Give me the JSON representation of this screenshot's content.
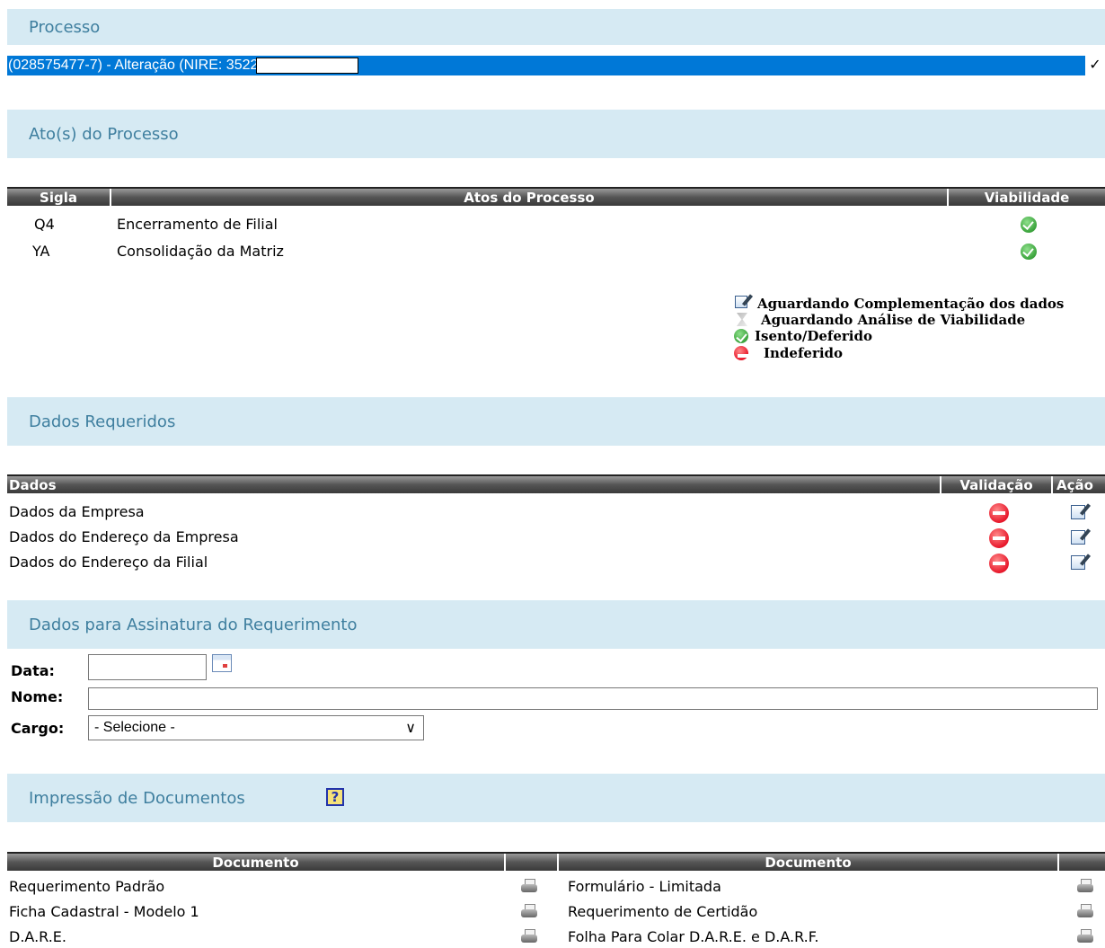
{
  "processo": {
    "title": "Processo",
    "selected": "(028575477-7) - Alteração (NIRE: 3522"
  },
  "atos": {
    "title": "Ato(s) do Processo",
    "headers": {
      "sigla": "Sigla",
      "atos": "Atos do Processo",
      "viabilidade": "Viabilidade"
    },
    "rows": [
      {
        "sigla": "Q4",
        "ato": "Encerramento de Filial",
        "status_icon": "check-circle-icon"
      },
      {
        "sigla": "YA",
        "ato": "Consolidação da Matriz",
        "status_icon": "check-circle-icon"
      }
    ],
    "legend": [
      {
        "icon": "edit-icon",
        "text": "Aguardando Complementação dos dados"
      },
      {
        "icon": "hourglass-icon",
        "text": "Aguardando Análise de Viabilidade"
      },
      {
        "icon": "check-circle-icon",
        "text": "Isento/Deferido"
      },
      {
        "icon": "minus-circle-icon",
        "text": "Indeferido"
      }
    ]
  },
  "dados": {
    "title": "Dados Requeridos",
    "headers": {
      "dados": "Dados",
      "validacao": "Validação",
      "acao": "Ação"
    },
    "rows": [
      {
        "label": "Dados da Empresa"
      },
      {
        "label": "Dados do Endereço da Empresa"
      },
      {
        "label": "Dados do Endereço da Filial"
      }
    ]
  },
  "assinatura": {
    "title": "Dados para Assinatura do Requerimento",
    "data_label": "Data:",
    "nome_label": "Nome:",
    "cargo_label": "Cargo:",
    "data_value": "",
    "nome_value": "",
    "cargo_selected": "- Selecione -"
  },
  "impressao": {
    "title": "Impressão de Documentos",
    "help": "?",
    "header_left": "Documento",
    "header_right": "Documento",
    "left": [
      "Requerimento Padrão",
      "Ficha Cadastral - Modelo 1",
      "D.A.R.E."
    ],
    "right": [
      "Formulário - Limitada",
      "Requerimento de Certidão",
      "Folha Para Colar D.A.R.E. e D.A.R.F."
    ]
  }
}
